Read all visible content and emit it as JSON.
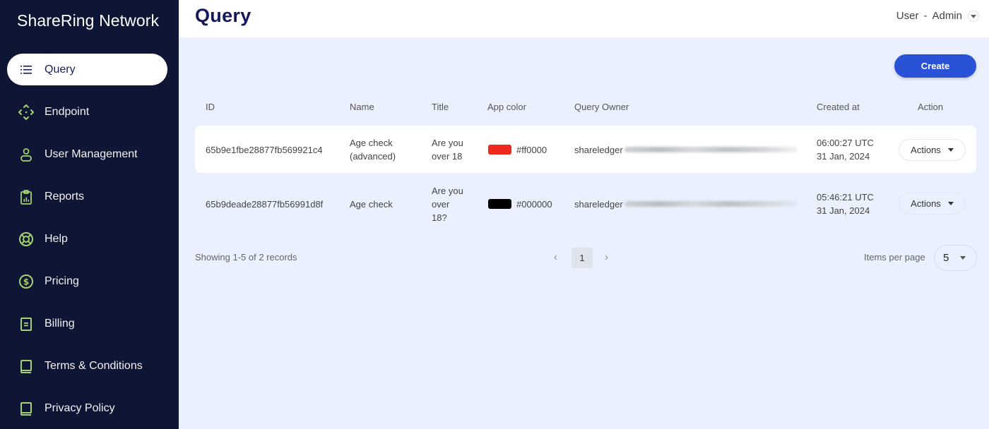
{
  "sidebar": {
    "brand": "ShareRing Network",
    "items": [
      {
        "label": "Query",
        "icon": "list-icon",
        "active": true
      },
      {
        "label": "Endpoint",
        "icon": "endpoint-arrows-icon"
      },
      {
        "label": "User Management",
        "icon": "user-icon"
      },
      {
        "label": "Reports",
        "icon": "clipboard-chart-icon"
      },
      {
        "label": "Help",
        "icon": "lifebuoy-icon"
      },
      {
        "label": "Pricing",
        "icon": "dollar-circle-icon"
      },
      {
        "label": "Billing",
        "icon": "receipt-icon"
      },
      {
        "label": "Terms & Conditions",
        "icon": "book-icon"
      },
      {
        "label": "Privacy Policy",
        "icon": "book-icon"
      }
    ],
    "icon_color": "#a3d36b"
  },
  "header": {
    "title": "Query",
    "user_label": "User",
    "separator": "-",
    "role": "Admin"
  },
  "toolbar": {
    "create_label": "Create",
    "accent": "#2a52d6"
  },
  "table": {
    "columns": [
      "ID",
      "Name",
      "Title",
      "App color",
      "Query Owner",
      "Created at",
      "Action"
    ],
    "rows": [
      {
        "id": "65b9e1fbe28877fb569921c4",
        "name_lines": [
          "Age check",
          "(advanced)"
        ],
        "title_lines": [
          "Are you",
          "over 18"
        ],
        "color": "#ff0000",
        "color_label": "#ff0000",
        "owner": "shareledger",
        "owner_redacted": true,
        "time": "06:00:27 UTC",
        "date": "31 Jan, 2024",
        "action_label": "Actions"
      },
      {
        "id": "65b9deade28877fb56991d8f",
        "name_lines": [
          "Age check"
        ],
        "title_lines": [
          "Are you",
          "over",
          "18?"
        ],
        "color": "#000000",
        "color_label": "#000000",
        "owner": "shareledger",
        "owner_redacted": true,
        "time": "05:46:21 UTC",
        "date": "31 Jan, 2024",
        "action_label": "Actions"
      }
    ]
  },
  "pagination": {
    "summary": "Showing 1-5 of 2 records",
    "prev": "‹",
    "next": "›",
    "current_page": "1",
    "items_per_page_label": "Items per page",
    "items_per_page": "5"
  }
}
